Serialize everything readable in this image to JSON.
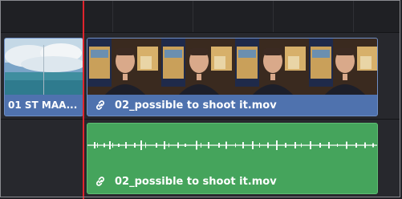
{
  "timeline": {
    "video_track": {
      "clips": [
        {
          "name": "01 ST MAA..."
        },
        {
          "name": "02_possible to shoot it.mov",
          "link_icon": "link-icon"
        }
      ]
    },
    "audio_track": {
      "clips": [
        {
          "name": "02_possible to shoot it.mov",
          "link_icon": "link-icon"
        }
      ]
    },
    "colors": {
      "video_clip": "#5b7eb8",
      "audio_clip": "#45a45c",
      "playhead": "#e0242c",
      "background": "#202126"
    }
  }
}
